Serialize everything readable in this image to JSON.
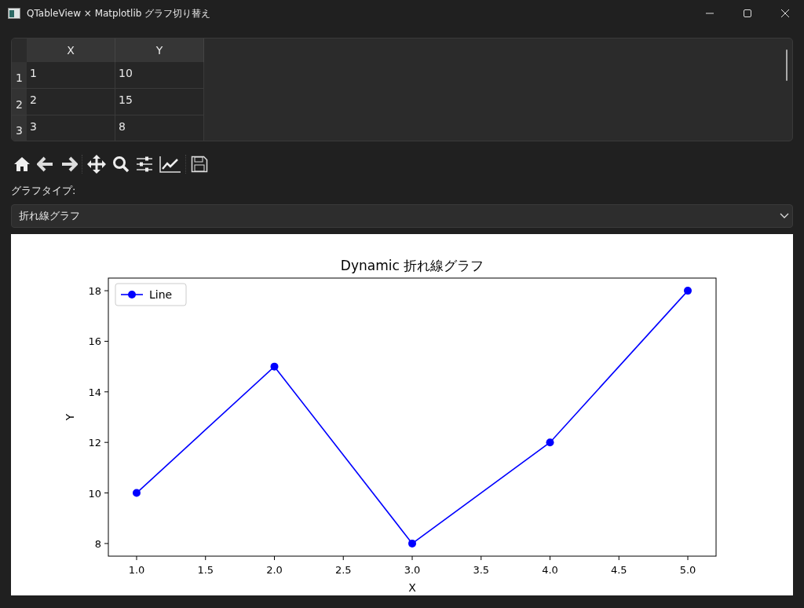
{
  "window": {
    "title": "QTableView × Matplotlib グラフ切り替え"
  },
  "table": {
    "columns": [
      "X",
      "Y"
    ],
    "rows": [
      {
        "header": "1",
        "cells": [
          "1",
          "10"
        ]
      },
      {
        "header": "2",
        "cells": [
          "2",
          "15"
        ]
      },
      {
        "header": "3",
        "cells": [
          "3",
          "8"
        ]
      }
    ]
  },
  "graph_type": {
    "label": "グラフタイプ:",
    "value": "折れ線グラフ"
  },
  "chart": {
    "chart_data": {
      "type": "line",
      "title": "Dynamic 折れ線グラフ",
      "xlabel": "X",
      "ylabel": "Y",
      "x": [
        1,
        2,
        3,
        4,
        5
      ],
      "series": [
        {
          "name": "Line",
          "color": "#0000ff",
          "marker": "o",
          "values": [
            10,
            15,
            8,
            12,
            18
          ]
        }
      ],
      "xlim": [
        0.795,
        5.205
      ],
      "ylim": [
        7.5,
        18.5
      ],
      "xticks": [
        {
          "value": 1,
          "label": "1.0"
        },
        {
          "value": 1.5,
          "label": "1.5"
        },
        {
          "value": 2,
          "label": "2.0"
        },
        {
          "value": 2.5,
          "label": "2.5"
        },
        {
          "value": 3,
          "label": "3.0"
        },
        {
          "value": 3.5,
          "label": "3.5"
        },
        {
          "value": 4,
          "label": "4.0"
        },
        {
          "value": 4.5,
          "label": "4.5"
        },
        {
          "value": 5,
          "label": "5.0"
        }
      ],
      "yticks": [
        8,
        10,
        12,
        14,
        16,
        18
      ]
    }
  }
}
